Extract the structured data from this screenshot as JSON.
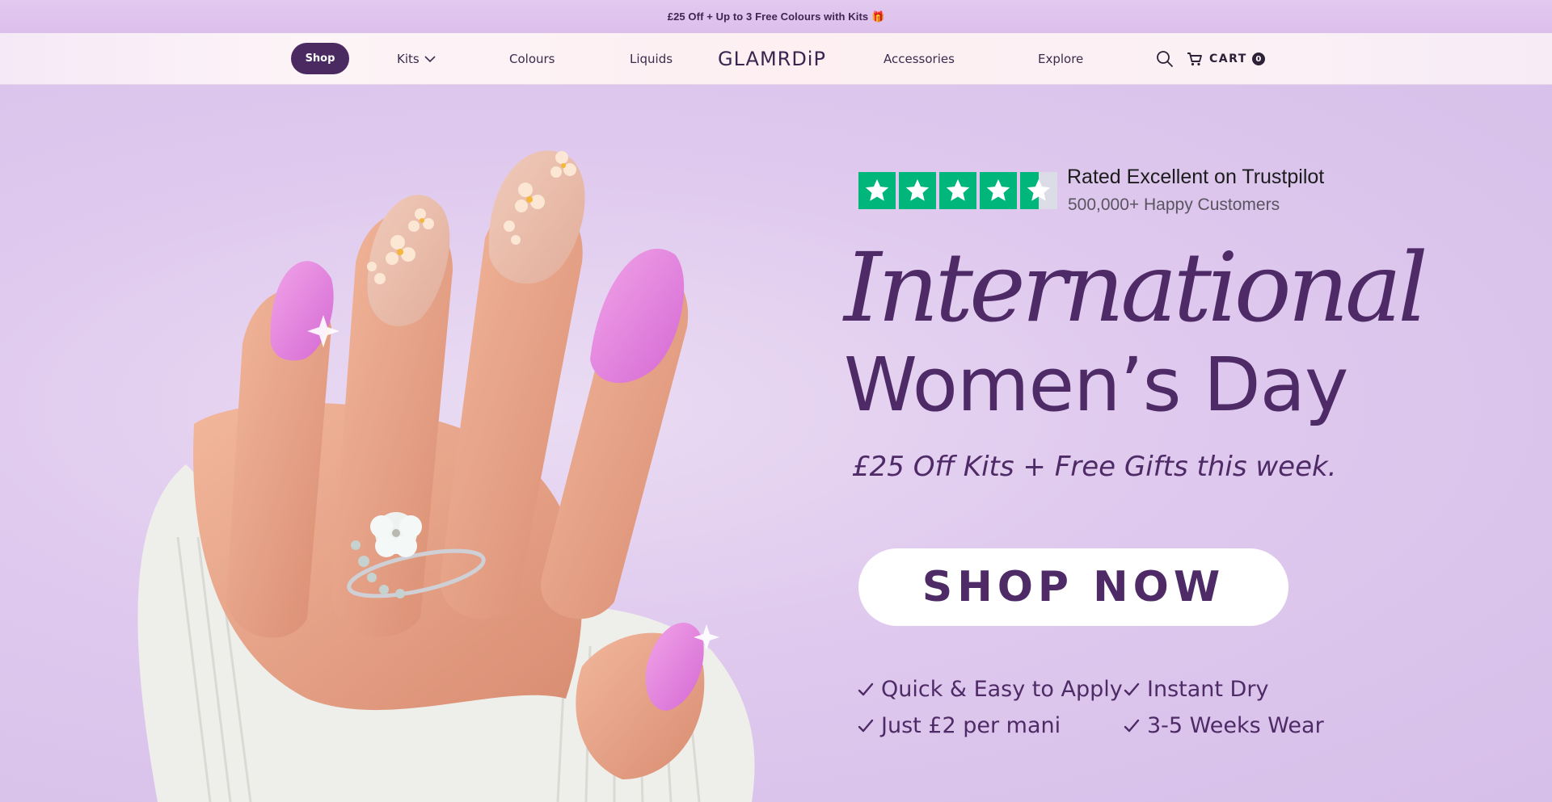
{
  "announcement": {
    "text": "£25 Off + Up to 3 Free Colours with Kits 🎁"
  },
  "nav": {
    "shop_label": "Shop",
    "kits_label": "Kits",
    "colours_label": "Colours",
    "liquids_label": "Liquids",
    "logo": "GLAMRDiP",
    "accessories_label": "Accessories",
    "explore_label": "Explore",
    "cart_label": "CART",
    "cart_count": "0"
  },
  "hero": {
    "trustpilot_title": "Rated Excellent on Trustpilot",
    "trustpilot_sub": "500,000+ Happy Customers",
    "trustpilot_rating": 4.5,
    "headline_script": "International",
    "headline_main": "Women’s Day",
    "subheading": "£25 Off Kits + Free Gifts this week.",
    "cta_label": "SHOP NOW",
    "features": [
      "Quick & Easy to Apply",
      "Instant Dry",
      "Just £2 per mani",
      "3-5 Weeks Wear"
    ]
  },
  "colors": {
    "brand_purple": "#4e2a66",
    "pill_purple": "#4b2a62",
    "trustpilot_green": "#00b67a",
    "hero_bg": "#dfc9ee"
  },
  "icons": [
    "search-icon",
    "cart-icon",
    "chevron-down-icon",
    "check-icon",
    "star-icon"
  ]
}
